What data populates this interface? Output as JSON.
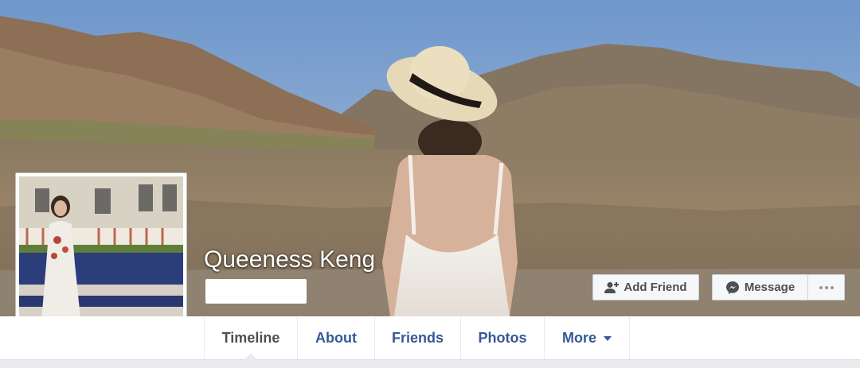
{
  "profile": {
    "name": "Queeness Keng"
  },
  "actions": {
    "add_friend_label": "Add Friend",
    "message_label": "Message"
  },
  "tabs": [
    {
      "label": "Timeline",
      "active": true
    },
    {
      "label": "About",
      "active": false
    },
    {
      "label": "Friends",
      "active": false
    },
    {
      "label": "Photos",
      "active": false
    },
    {
      "label": "More",
      "active": false
    }
  ],
  "colors": {
    "link_blue": "#365899",
    "button_bg": "#f6f7f9",
    "button_border": "#ced0d4",
    "page_bg": "#e9ebee"
  },
  "icons": {
    "add_friend": "add-friend-icon",
    "message": "messenger-icon",
    "more": "more-dots-icon",
    "dropdown": "caret-down-icon"
  }
}
